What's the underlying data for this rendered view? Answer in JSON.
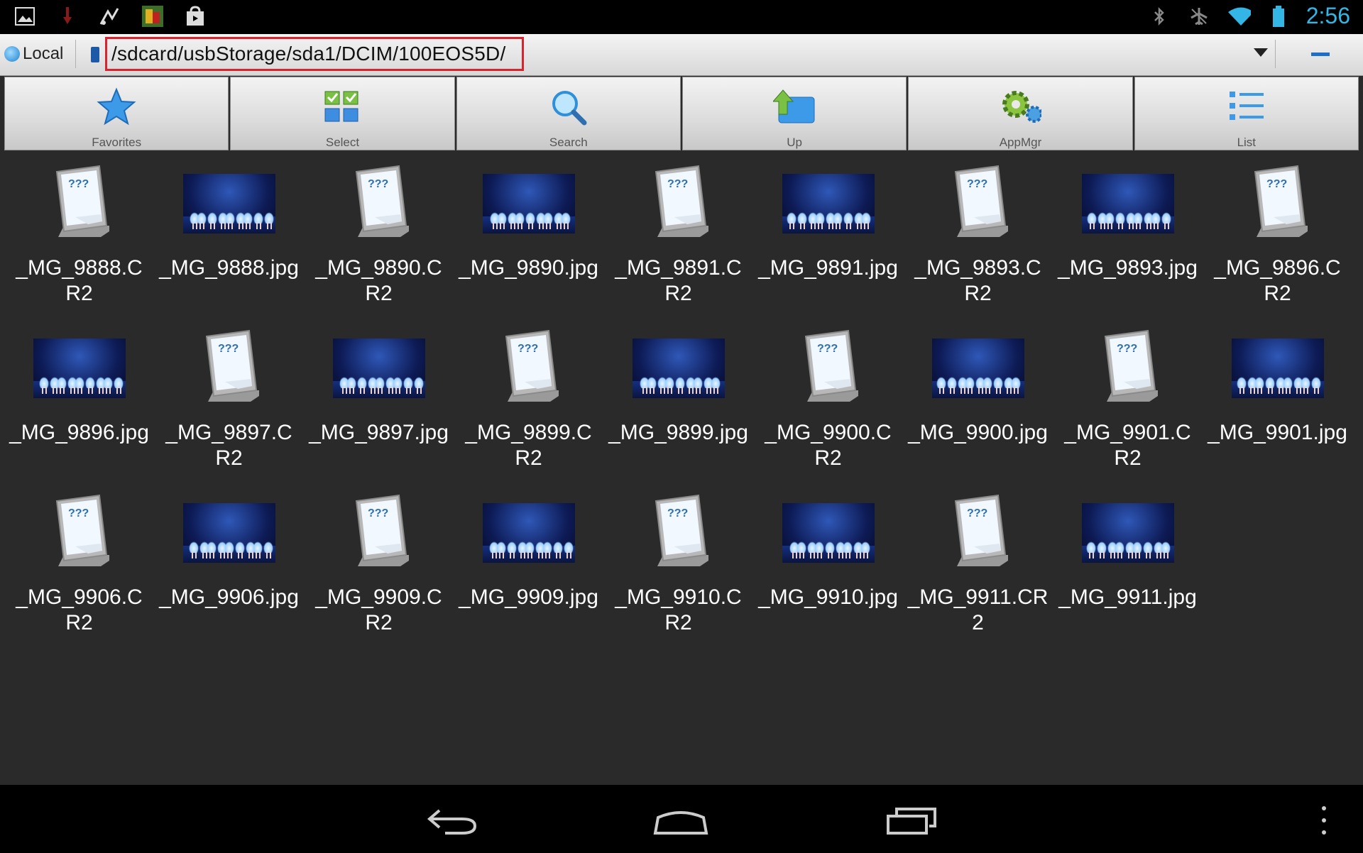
{
  "status_bar": {
    "left_icons": [
      "gallery-icon",
      "download-icon",
      "music-share-icon",
      "app-notification-icon",
      "shopping-bag-icon"
    ],
    "right_icons": [
      "bluetooth-icon",
      "airplane-off-icon",
      "wifi-icon",
      "battery-icon"
    ],
    "time": "2:56",
    "accent_color": "#33b5e5"
  },
  "path_bar": {
    "location_label": "Local",
    "path": "/sdcard/usbStorage/sda1/DCIM/100EOS5D/",
    "highlight_color": "#d9232e"
  },
  "toolbar": {
    "items": [
      {
        "label": "Favorites",
        "icon": "star-icon"
      },
      {
        "label": "Select",
        "icon": "select-checkboxes-icon"
      },
      {
        "label": "Search",
        "icon": "magnifier-icon"
      },
      {
        "label": "Up",
        "icon": "folder-up-icon"
      },
      {
        "label": "AppMgr",
        "icon": "gear-icon"
      },
      {
        "label": "List",
        "icon": "list-icon"
      }
    ]
  },
  "files": [
    {
      "name": "_MG_9888.CR2",
      "type": "unknown"
    },
    {
      "name": "_MG_9888.jpg",
      "type": "image"
    },
    {
      "name": "_MG_9890.CR2",
      "type": "unknown"
    },
    {
      "name": "_MG_9890.jpg",
      "type": "image"
    },
    {
      "name": "_MG_9891.CR2",
      "type": "unknown"
    },
    {
      "name": "_MG_9891.jpg",
      "type": "image"
    },
    {
      "name": "_MG_9893.CR2",
      "type": "unknown"
    },
    {
      "name": "_MG_9893.jpg",
      "type": "image"
    },
    {
      "name": "_MG_9896.CR2",
      "type": "unknown"
    },
    {
      "name": "_MG_9896.jpg",
      "type": "image"
    },
    {
      "name": "_MG_9897.CR2",
      "type": "unknown"
    },
    {
      "name": "_MG_9897.jpg",
      "type": "image"
    },
    {
      "name": "_MG_9899.CR2",
      "type": "unknown"
    },
    {
      "name": "_MG_9899.jpg",
      "type": "image"
    },
    {
      "name": "_MG_9900.CR2",
      "type": "unknown"
    },
    {
      "name": "_MG_9900.jpg",
      "type": "image"
    },
    {
      "name": "_MG_9901.CR2",
      "type": "unknown"
    },
    {
      "name": "_MG_9901.jpg",
      "type": "image"
    },
    {
      "name": "_MG_9906.CR2",
      "type": "unknown"
    },
    {
      "name": "_MG_9906.jpg",
      "type": "image"
    },
    {
      "name": "_MG_9909.CR2",
      "type": "unknown"
    },
    {
      "name": "_MG_9909.jpg",
      "type": "image"
    },
    {
      "name": "_MG_9910.CR2",
      "type": "unknown"
    },
    {
      "name": "_MG_9910.jpg",
      "type": "image"
    },
    {
      "name": "_MG_9911.CR2",
      "type": "unknown"
    },
    {
      "name": "_MG_9911.jpg",
      "type": "image"
    }
  ],
  "nav_bar": {
    "buttons": [
      "back-icon",
      "home-icon",
      "recent-apps-icon",
      "overflow-menu-icon"
    ]
  }
}
